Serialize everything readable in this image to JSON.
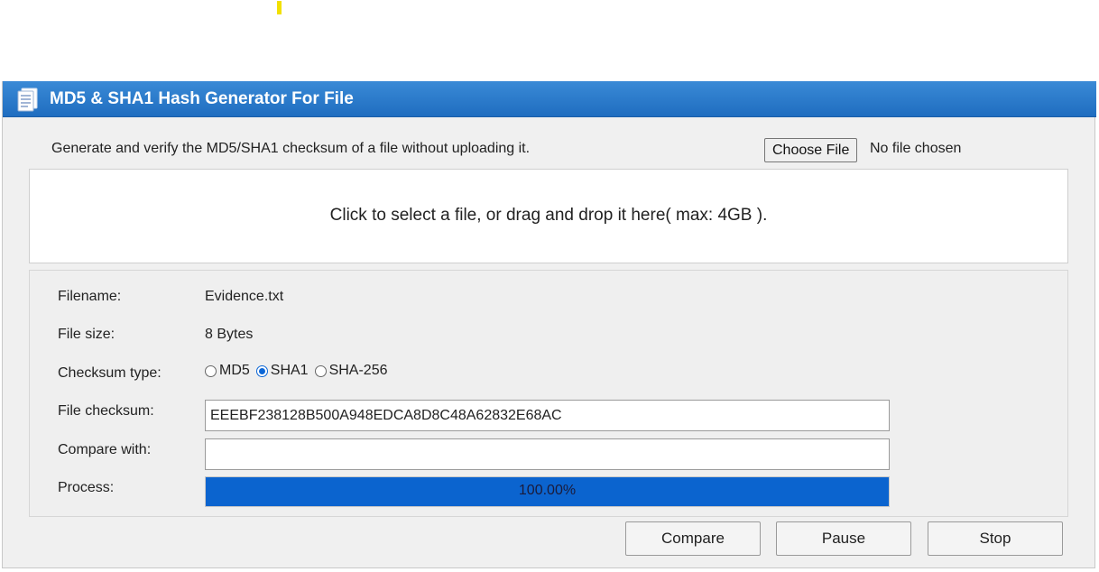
{
  "window": {
    "title": "MD5 & SHA1 Hash Generator For File"
  },
  "intro": {
    "description": "Generate and verify the MD5/SHA1 checksum of a file without uploading it.",
    "choose_file_label": "Choose File",
    "no_file_text": "No file chosen"
  },
  "dropzone": {
    "text": "Click to select a file, or drag and drop it here( max: 4GB )."
  },
  "info": {
    "filename_label": "Filename:",
    "filename_value": "Evidence.txt",
    "filesize_label": "File size:",
    "filesize_value": "8 Bytes",
    "checksum_type_label": "Checksum type:",
    "checksum_types": [
      {
        "label": "MD5",
        "checked": false
      },
      {
        "label": "SHA1",
        "checked": true
      },
      {
        "label": "SHA-256",
        "checked": false
      }
    ],
    "file_checksum_label": "File checksum:",
    "file_checksum_value": "EEEBF238128B500A948EDCA8D8C48A62832E68AC",
    "compare_label": "Compare with:",
    "compare_value": "",
    "process_label": "Process:",
    "process_percent": 100,
    "process_text": "100.00%"
  },
  "buttons": {
    "compare": "Compare",
    "pause": "Pause",
    "stop": "Stop"
  },
  "colors": {
    "titlebar": "#1f6dc0",
    "progress_fill": "#0b64cf",
    "radio_accent": "#0b66d6"
  },
  "icons": {
    "app": "document-icon"
  }
}
